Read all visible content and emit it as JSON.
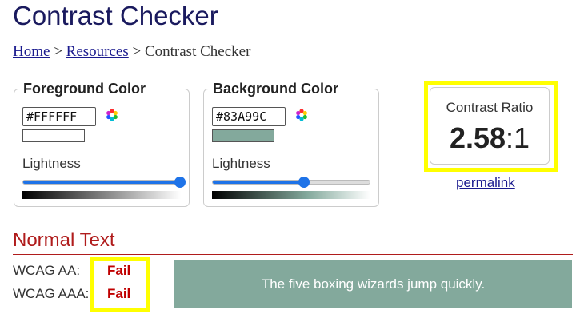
{
  "title": "Contrast Checker",
  "breadcrumb": {
    "home": "Home",
    "separator": ">",
    "resources": "Resources",
    "current": "Contrast Checker"
  },
  "foreground": {
    "legend": "Foreground Color",
    "hex": "#FFFFFF",
    "swatch_color": "#FFFFFF",
    "lightness_label": "Lightness",
    "lightness_percent": 100,
    "picker_icon": "color-wheel-icon"
  },
  "background": {
    "legend": "Background Color",
    "hex": "#83A99C",
    "swatch_color": "#83A99C",
    "lightness_label": "Lightness",
    "lightness_percent": 58,
    "picker_icon": "color-wheel-icon"
  },
  "ratio": {
    "label": "Contrast Ratio",
    "value": "2.58",
    "suffix": ":1",
    "permalink": "permalink"
  },
  "normal_text": {
    "heading": "Normal Text",
    "aa_label": "WCAG AA:",
    "aa_result": "Fail",
    "aaa_label": "WCAG AAA:",
    "aaa_result": "Fail",
    "sample_text": "The five boxing wizards jump quickly."
  },
  "colors": {
    "title": "#1a1a5e",
    "link": "#1a1a8e",
    "heading_red": "#b01c1c",
    "fail_red": "#c00000",
    "highlight": "#ffff00",
    "slider": "#1e73e8"
  }
}
